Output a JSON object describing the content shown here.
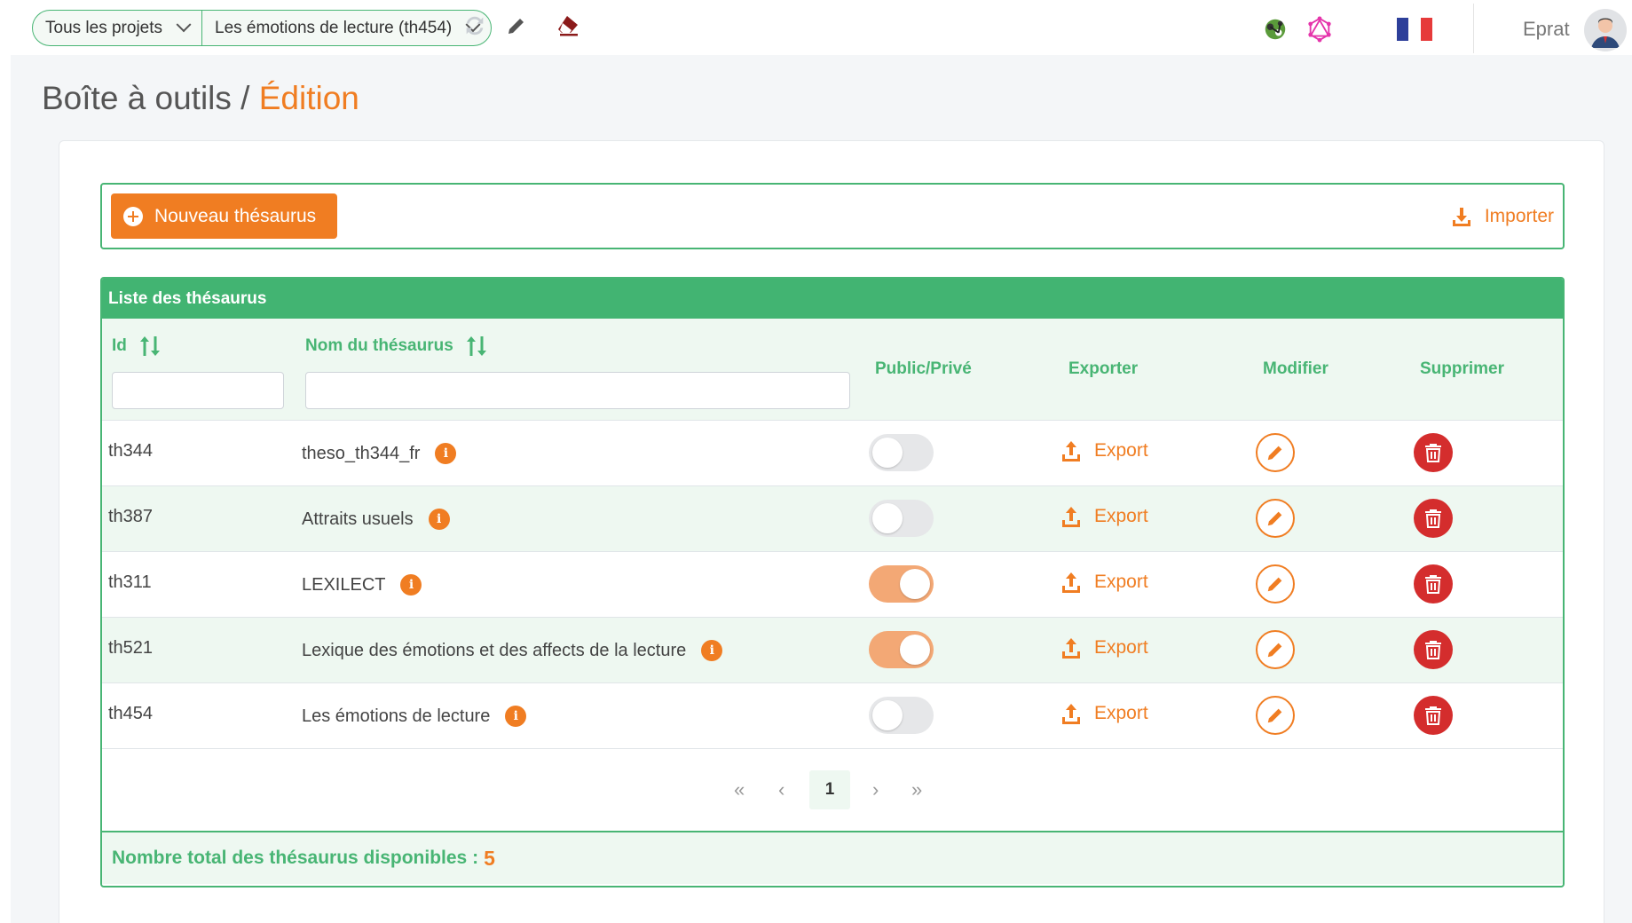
{
  "header": {
    "project_selector": "Tous les projets",
    "thesaurus_selector": "Les émotions de lecture (th454)",
    "user_name": "Eprat",
    "colors": {
      "accent": "#f07d22",
      "green": "#48b574",
      "danger": "#d42d2d"
    }
  },
  "page": {
    "breadcrumb_root": "Boîte à outils",
    "separator": " / ",
    "breadcrumb_current": "Édition"
  },
  "toolbar": {
    "new_label": "Nouveau thésaurus",
    "import_label": "Importer"
  },
  "table": {
    "caption": "Liste des thésaurus",
    "columns": {
      "id": "Id",
      "name": "Nom du thésaurus",
      "public": "Public/Privé",
      "export": "Exporter",
      "edit": "Modifier",
      "delete": "Supprimer"
    },
    "filters": {
      "id": "",
      "name": ""
    },
    "export_label": "Export",
    "rows": [
      {
        "id": "th344",
        "name": "theso_th344_fr",
        "public": false
      },
      {
        "id": "th387",
        "name": "Attraits usuels",
        "public": false
      },
      {
        "id": "th311",
        "name": "LEXILECT",
        "public": true
      },
      {
        "id": "th521",
        "name": "Lexique des émotions et des affects de la lecture",
        "public": true
      },
      {
        "id": "th454",
        "name": "Les émotions de lecture",
        "public": false
      }
    ]
  },
  "pagination": {
    "first": "«",
    "prev": "‹",
    "current": "1",
    "next": "›",
    "last": "»"
  },
  "footer": {
    "total_label": "Nombre total des thésaurus disponibles :",
    "total_value": "5"
  }
}
